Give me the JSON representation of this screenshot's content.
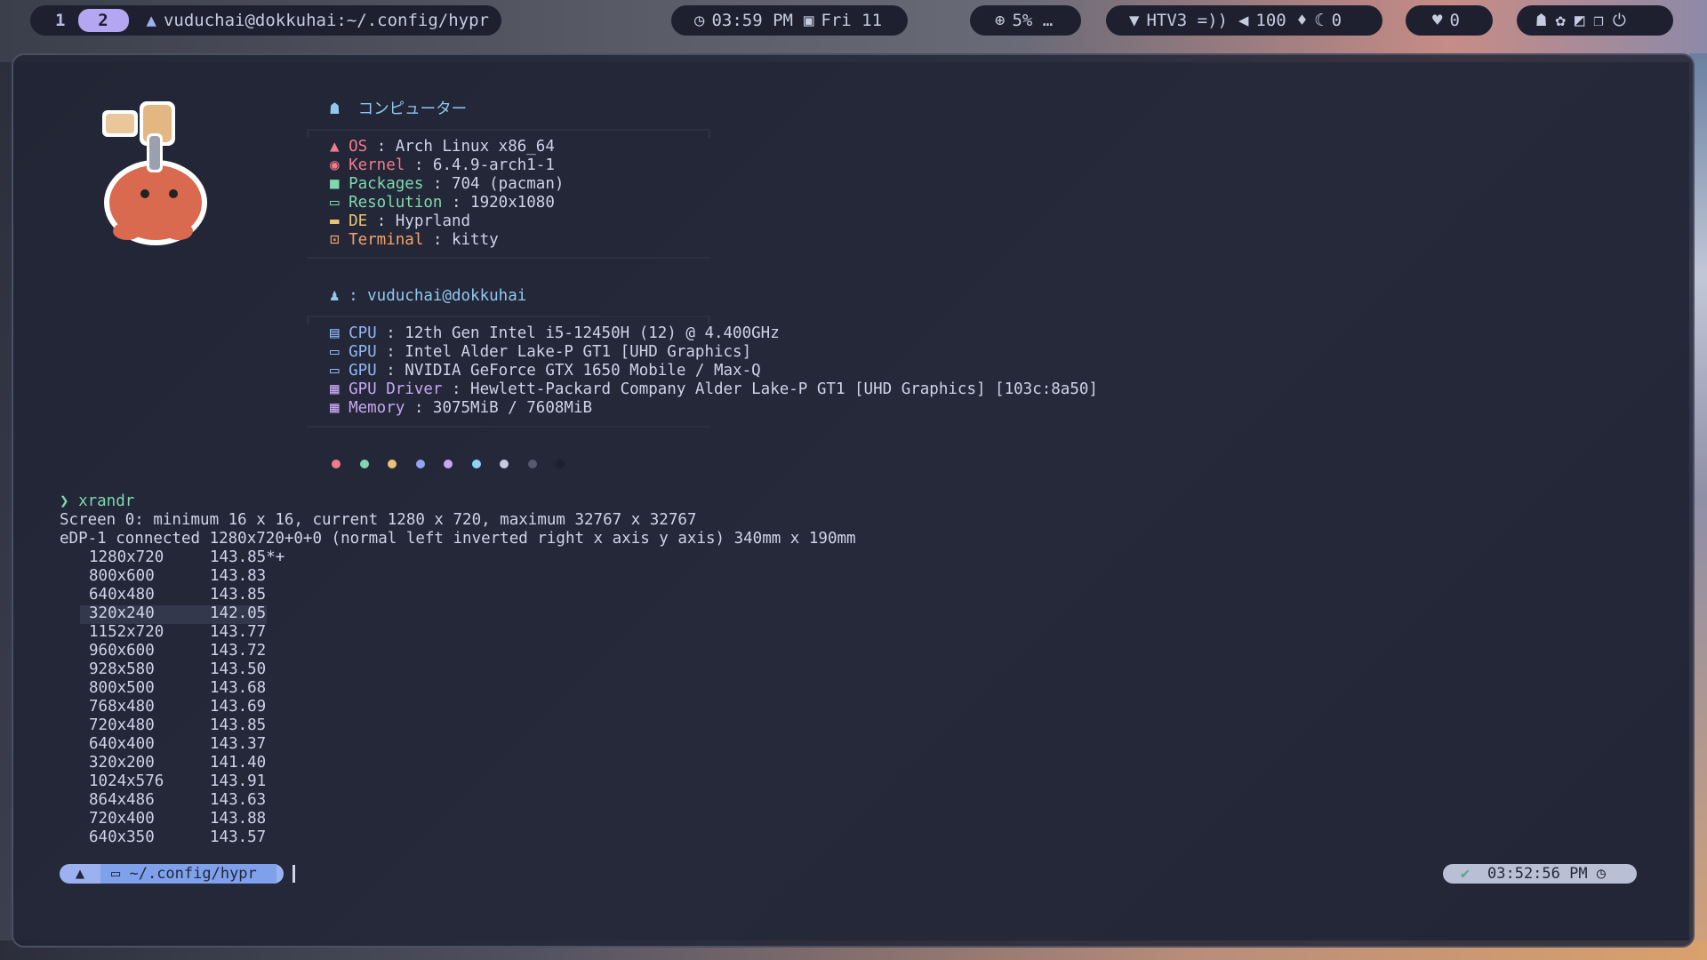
{
  "topbar": {
    "workspaces": [
      "1",
      "2"
    ],
    "active_workspace": "2",
    "window_title": "vuduchai@dokkuhai:~/.config/hypr",
    "clock": "03:59 PM",
    "date": "Fri 11",
    "cpu": "5% …",
    "wifi": "HTV3 =))",
    "volume": "100",
    "mic": "0",
    "notifications": "0",
    "brand_color": "#b4a6f0"
  },
  "fetch": {
    "section1_title": "コンピューター",
    "section1": [
      {
        "key": "OS",
        "value": "Arch Linux x86_64"
      },
      {
        "key": "Kernel",
        "value": "6.4.9-arch1-1"
      },
      {
        "key": "Packages",
        "value": "704 (pacman)"
      },
      {
        "key": "Resolution",
        "value": "1920x1080"
      },
      {
        "key": "DE",
        "value": "Hyprland"
      },
      {
        "key": "Terminal",
        "value": "kitty"
      }
    ],
    "section2_title": ": vuduchai@dokkuhai",
    "section2": [
      {
        "key": "CPU",
        "value": "12th Gen Intel i5-12450H (12) @ 4.400GHz"
      },
      {
        "key": "GPU",
        "value": "Intel Alder Lake-P GT1 [UHD Graphics]"
      },
      {
        "key": "GPU",
        "value": "NVIDIA GeForce GTX 1650 Mobile / Max-Q"
      },
      {
        "key": "GPU Driver",
        "value": "Hewlett-Packard Company Alder Lake-P GT1 [UHD Graphics] [103c:8a50]"
      },
      {
        "key": "Memory",
        "value": "3075MiB / 7608MiB"
      }
    ],
    "palette": [
      "#ee7c8d",
      "#7fd8b0",
      "#e7c27a",
      "#8fa6f2",
      "#c7a6f2",
      "#8fd3f5",
      "#c6cbe0",
      "#585b70",
      "#1e2030"
    ]
  },
  "terminal": {
    "command": "xrandr",
    "line1": "Screen 0: minimum 16 x 16, current 1280 x 720, maximum 32767 x 32767",
    "line2": "eDP-1 connected 1280x720+0+0 (normal left inverted right x axis y axis) 340mm x 190mm",
    "modes": [
      {
        "res": "1280x720",
        "rate": "143.85*+"
      },
      {
        "res": "800x600",
        "rate": "143.83"
      },
      {
        "res": "640x480",
        "rate": "143.85"
      },
      {
        "res": "320x240",
        "rate": "142.05"
      },
      {
        "res": "1152x720",
        "rate": "143.77"
      },
      {
        "res": "960x600",
        "rate": "143.72"
      },
      {
        "res": "928x580",
        "rate": "143.50"
      },
      {
        "res": "800x500",
        "rate": "143.68"
      },
      {
        "res": "768x480",
        "rate": "143.69"
      },
      {
        "res": "720x480",
        "rate": "143.85"
      },
      {
        "res": "640x400",
        "rate": "143.37"
      },
      {
        "res": "320x200",
        "rate": "141.40"
      },
      {
        "res": "1024x576",
        "rate": "143.91"
      },
      {
        "res": "864x486",
        "rate": "143.63"
      },
      {
        "res": "720x400",
        "rate": "143.88"
      },
      {
        "res": "640x350",
        "rate": "143.57"
      }
    ],
    "prompt_dir": "~/.config/hypr",
    "right_time": "03:52:56 PM"
  }
}
